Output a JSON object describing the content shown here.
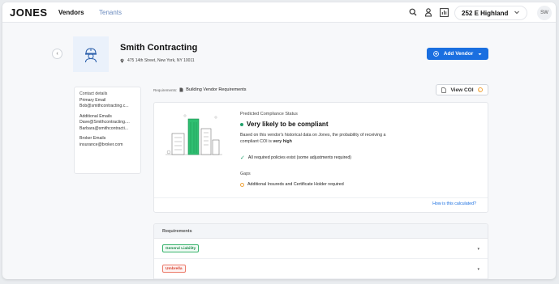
{
  "nav": {
    "logo": "JONES",
    "tabs": [
      {
        "label": "Vendors",
        "active": true
      },
      {
        "label": "Tenants",
        "active": false
      }
    ],
    "icons": [
      "search-icon",
      "user-icon",
      "chart-icon"
    ],
    "building": "252 E Highland",
    "avatar_initials": "SW"
  },
  "vendor": {
    "name": "Smith Contracting",
    "address": "475 14th Street, New York, NY 10011",
    "add_vendor_label": "Add Vendor"
  },
  "contact": {
    "title": "Contact details",
    "primary_email_label": "Primary Email",
    "primary_email": "Bob@smithcontracting.c...",
    "additional_emails_label": "Additional Emails",
    "additional_emails": [
      "Dave@Smithcontracting....",
      "Barbara@smithcontracti..."
    ],
    "broker_emails_label": "Broker Emails",
    "broker_email": "insurance@broker.com"
  },
  "requirements_header": {
    "label": "Requirements:",
    "value": "Building Vendor Requirements",
    "view_coi_label": "View COI"
  },
  "compliance": {
    "label": "Predicted Compliance Status",
    "status": "Very likely to be compliant",
    "desc_prefix": "Based on this vendor's historical data on Jones, the probability of receiving a compliant COI is",
    "desc_emphasis": "very high",
    "check_text": "All required policies exist (some adjustments required)",
    "gaps_label": "Gaps",
    "gap_text": "Additional Insureds and Certificate Holder required",
    "how_link": "How is this calculated?",
    "colors": {
      "success": "#22a06b",
      "warning": "#f0a43a",
      "accent": "#1a6fe0"
    }
  },
  "requirements_table": {
    "title": "Requirements",
    "rows": [
      {
        "label": "General Liability",
        "status": "ok"
      },
      {
        "label": "Umbrella",
        "status": "bad"
      }
    ]
  }
}
